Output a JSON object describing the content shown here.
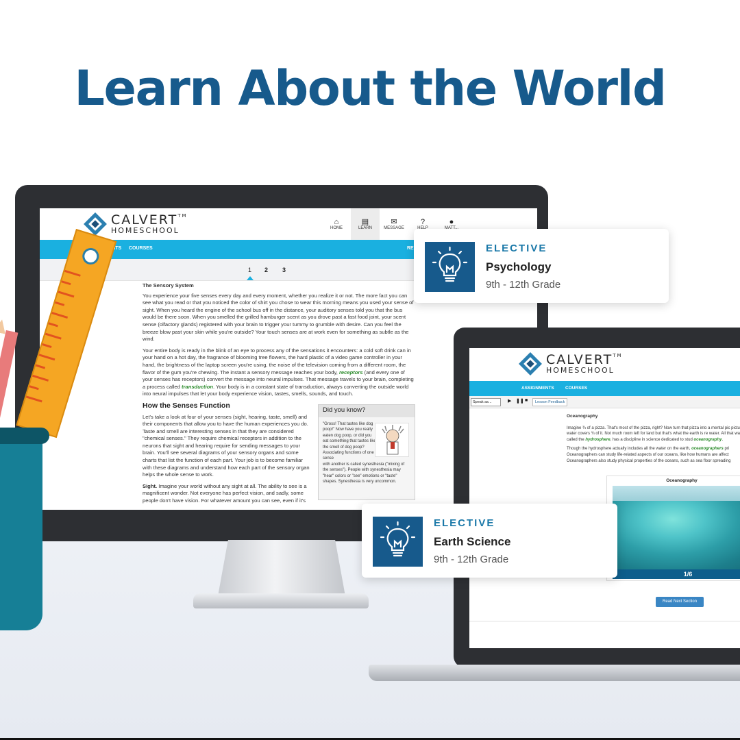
{
  "headline": "Learn About the World",
  "brand": {
    "name": "CALVERT",
    "tm": "TM",
    "sub": "HOMESCHOOL"
  },
  "desktop": {
    "nav": [
      {
        "icon": "⌂",
        "label": "HOME"
      },
      {
        "icon": "▤",
        "label": "LEARN"
      },
      {
        "icon": "✉",
        "label": "MESSAGE"
      },
      {
        "icon": "?",
        "label": "HELP"
      },
      {
        "icon": "●",
        "label": "MATT..."
      }
    ],
    "tabs": [
      "ASSIGNMENTS",
      "COURSES"
    ],
    "tab_right": "REA",
    "pages": [
      "1",
      "2",
      "3"
    ],
    "section_title": "The Sensory System",
    "p1": "You experience your five senses every day and every moment, whether you realize it or not. The more fact you can see what you read or that you noticed the color of shirt you chose to wear this morning means you used your sense of sight. When you heard the engine of the school bus off in the distance, your auditory senses told you that the bus would be there soon. When you smelled the grilled hamburger scent as you drove past a fast food joint, your scent sense (olfactory glands) registered with your brain to trigger your tummy to grumble with desire. Can you feel the breeze blow past your skin while you're outside? Your touch senses are at work even for something as subtle as the wind.",
    "p2_a": "Your entire body is ready in the blink of an eye to process any of the sensations it encounters: a cold soft drink can in your hand on a hot day, the fragrance of blooming tree flowers, the hard plastic of a video game controller in your hand, the brightness of the laptop screen you're using, the noise of the television coming from a different room, the flavor of the gum you're chewing. The instant a sensory message reaches your body, ",
    "p2_term1": "receptors",
    "p2_b": " (and every one of your senses has receptors) convert the message into neural impulses. That message travels to your brain, completing a process called ",
    "p2_term2": "transduction",
    "p2_c": ". Your body is in a constant state of transduction, always converting the outside world into neural impulses that let your body experience vision, tastes, smells, sounds, and touch.",
    "h3": "How the Senses Function",
    "p3": "Let's take a look at four of your senses (sight, hearing, taste, smell) and their components that allow you to have the human experiences you do. Taste and smell are interesting senses in that they are considered \"chemical senses.\" They require chemical receptors in addition to the neurons that sight and hearing require for sending messages to your brain. You'll see several diagrams of your sensory organs and some charts that list the function of each part. Your job is to become familiar with these diagrams and understand how each part of the sensory organ helps the whole sense to work.",
    "p4_lead": "Sight.",
    "p4": " Imagine your world without any sight at all. The ability to see is a magnificent wonder. Not everyone has perfect vision, and sadly, some people don't have vision. For whatever amount you can see, even if it's",
    "dyk_title": "Did you know?",
    "dyk_text1": "\"Gross! That tastes like dog poop!\" Now have you really eaten dog poop, or did you eat something that tastes like the smell of dog poop? Associating functions of one sense",
    "dyk_text2": "with another is called synesthesia (\"mixing of the senses\"). People with synesthesia may \"hear\" colors or \"see\" emotions or \"taste\" shapes. Synesthesia is very uncommon."
  },
  "laptop": {
    "tabs": [
      "ASSIGNMENTS",
      "COURSES"
    ],
    "speak": "Speak as...",
    "feedback": "Lesson Feedback",
    "title": "Oceanography",
    "p1_a": "Imagine ¾ of a pizza. That's most of the pizza, right? Now turn that pizza into a mental pic picture that water covers ¾ of it. Not much room left for land but that's what the earth is re water. All that water, called the ",
    "p1_term1": "hydrosphere",
    "p1_b": ", has a discipline in science dedicated to stud ",
    "p1_term2": "oceanography",
    "p1_c": ".",
    "p2_a": "Though the hydrosphere actually includes all the water on the earth, ",
    "p2_term": "oceanographers",
    "p2_b": " pri Oceanographers can study life-related aspects of our oceans, like how humans are affect Oceanographers also study physical properties of the oceans, such as sea floor spreading",
    "figure_title": "Oceanography",
    "figure_counter": "1/6",
    "read_next": "Read Next Section"
  },
  "cards": [
    {
      "kicker": "ELECTIVE",
      "title": "Psychology",
      "grade": "9th - 12th Grade"
    },
    {
      "kicker": "ELECTIVE",
      "title": "Earth Science",
      "grade": "9th - 12th Grade"
    }
  ],
  "colors": {
    "brand": "#175a8c",
    "accent": "#1ab0e0",
    "term": "#2a8a2a"
  }
}
